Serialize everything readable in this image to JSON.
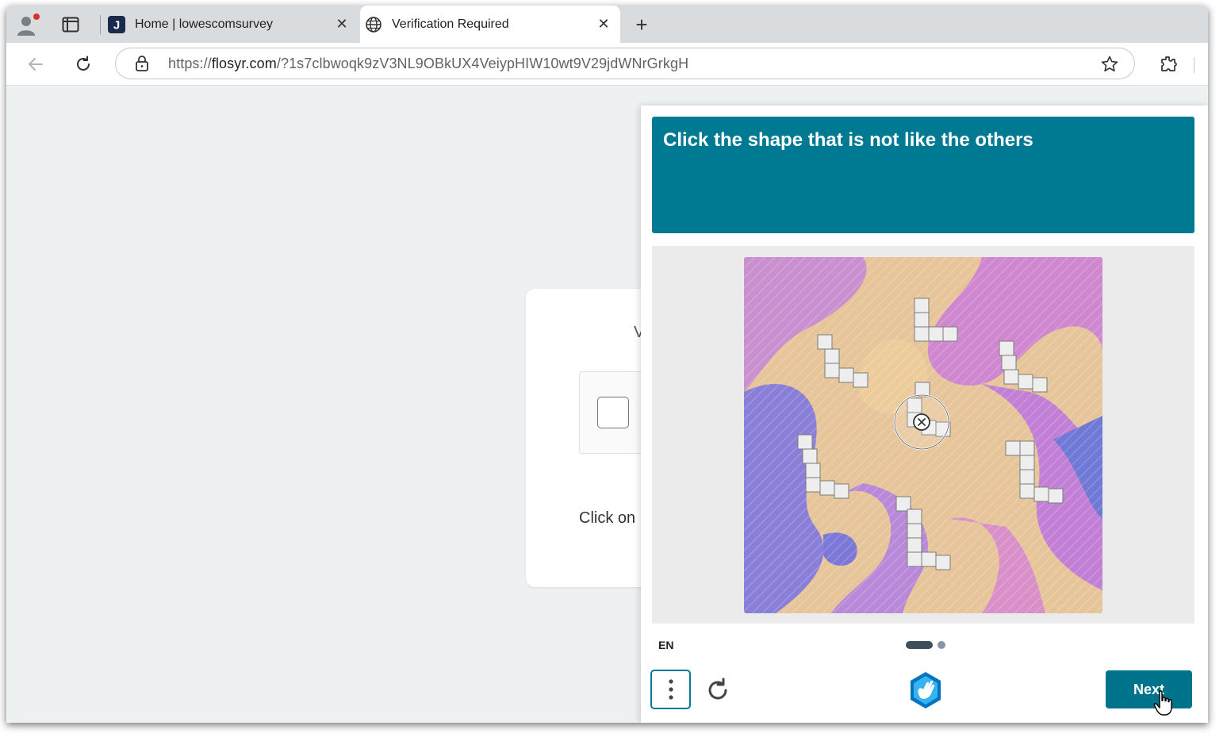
{
  "browser": {
    "tabs": [
      {
        "title": "Home | lowescomsurvey",
        "favicon": "J"
      },
      {
        "title": "Verification Required",
        "favicon": "globe-icon"
      }
    ],
    "new_tab_label": "+",
    "url_prefix": "https://",
    "url_domain": "flosyr.com",
    "url_path": "/?1s7clbwoqk9zV3NL9OBkUX4VeiypHIW10wt9V29jdWNrGrkgH"
  },
  "page": {
    "card_heading_partial": "V",
    "card_hint_partial": "Click on"
  },
  "captcha": {
    "prompt": "Click the shape that is not like the others",
    "language": "EN",
    "next_label": "Next",
    "page_current": 1,
    "page_total": 2
  },
  "colors": {
    "accent": "#007a93",
    "next_button": "#00738c"
  }
}
